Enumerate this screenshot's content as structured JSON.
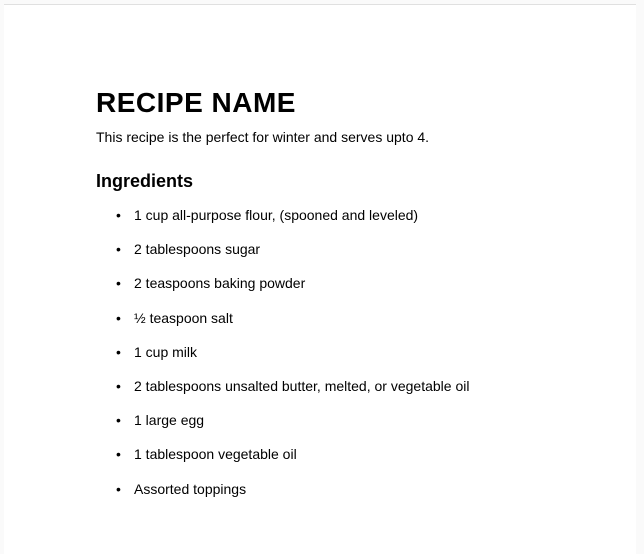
{
  "title": "RECIPE NAME",
  "subtitle": "This recipe is the perfect for winter and serves upto 4.",
  "ingredients_heading": "Ingredients",
  "ingredients": [
    "1 cup all-purpose flour, (spooned and leveled)",
    "2 tablespoons sugar",
    "2 teaspoons baking powder",
    "½ teaspoon salt",
    "1 cup milk",
    "2 tablespoons unsalted butter, melted, or vegetable oil",
    "1 large egg",
    "1 tablespoon vegetable oil",
    "Assorted toppings"
  ]
}
